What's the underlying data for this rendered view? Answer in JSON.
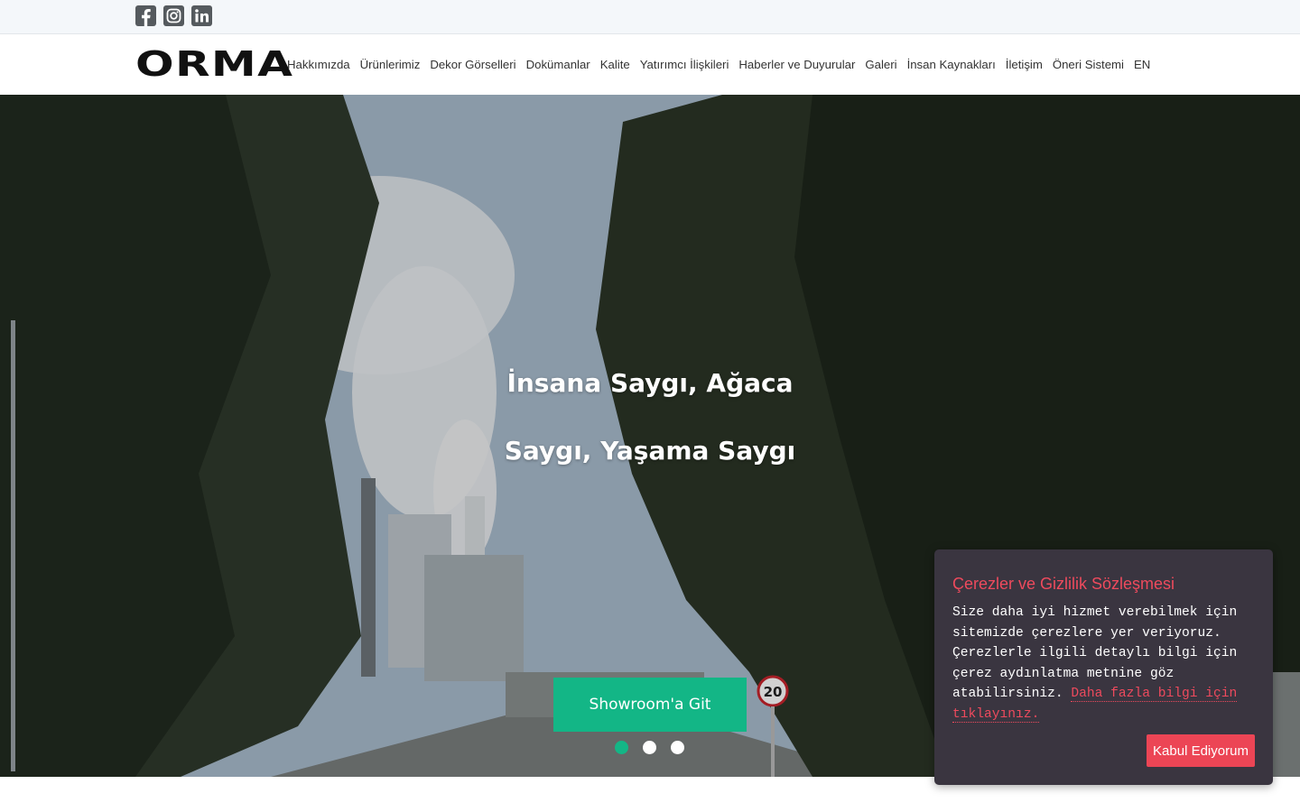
{
  "social": {
    "icons": [
      "facebook-icon",
      "instagram-icon",
      "linkedin-icon"
    ]
  },
  "header": {
    "logo": "ORMA",
    "nav": [
      "Hakkımızda",
      "Ürünlerimiz",
      "Dekor Görselleri",
      "Dokümanlar",
      "Kalite",
      "Yatırımcı İlişkileri",
      "Haberler ve Duyurular",
      "Galeri",
      "İnsan Kaynakları",
      "İletişim",
      "Öneri Sistemi",
      "EN"
    ]
  },
  "hero": {
    "title_line1": "İnsana Saygı, Ağaca",
    "title_line2": "Saygı, Yaşama Saygı",
    "cta_label": "Showroom'a Git",
    "slides": 3,
    "active_slide": 1
  },
  "cookie": {
    "title": "Çerezler ve Gizlilik Sözleşmesi",
    "text": "Size daha iyi hizmet verebilmek için sitemizde çerezlere yer veriyoruz. Çerezlerle ilgili detaylı bilgi için çerez aydınlatma metnine göz atabilirsiniz.",
    "link": "Daha fazla bilgi için tıklayınız.",
    "button": "Kabul Ediyorum"
  },
  "colors": {
    "accent": "#13b686",
    "cookie_bg": "#3a3540",
    "cookie_accent": "#ec4555"
  }
}
